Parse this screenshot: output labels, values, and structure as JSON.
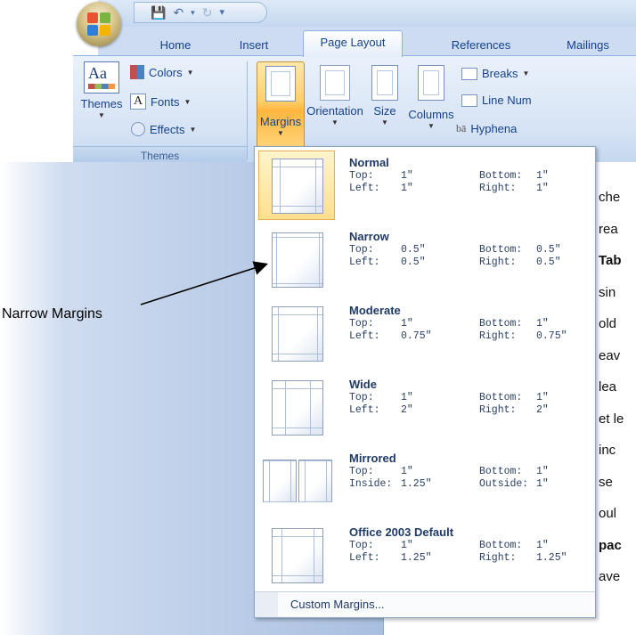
{
  "quick_access": {
    "icons": [
      "save-icon",
      "undo-icon",
      "redo-icon",
      "customize-icon"
    ]
  },
  "tabs": [
    {
      "label": "Home",
      "active": false
    },
    {
      "label": "Insert",
      "active": false
    },
    {
      "label": "Page Layout",
      "active": true
    },
    {
      "label": "References",
      "active": false
    },
    {
      "label": "Mailings",
      "active": false
    }
  ],
  "ribbon": {
    "themes_group": {
      "label": "Themes",
      "themes_button": "Themes",
      "colors": "Colors",
      "fonts": "Fonts",
      "effects": "Effects"
    },
    "page_setup": {
      "margins": "Margins",
      "orientation": "Orientation",
      "size": "Size",
      "columns": "Columns",
      "breaks": "Breaks",
      "line_numbers": "Line Num",
      "hyphenation": "Hyphena"
    }
  },
  "margins_gallery": {
    "items": [
      {
        "name": "Normal",
        "row1_label": "Top:",
        "row1_value": "1\"",
        "row1_label2": "Bottom:",
        "row1_value2": "1\"",
        "row2_label": "Left:",
        "row2_value": "1\"",
        "row2_label2": "Right:",
        "row2_value2": "1\"",
        "selected": true
      },
      {
        "name": "Narrow",
        "row1_label": "Top:",
        "row1_value": "0.5\"",
        "row1_label2": "Bottom:",
        "row1_value2": "0.5\"",
        "row2_label": "Left:",
        "row2_value": "0.5\"",
        "row2_label2": "Right:",
        "row2_value2": "0.5\"",
        "selected": false
      },
      {
        "name": "Moderate",
        "row1_label": "Top:",
        "row1_value": "1\"",
        "row1_label2": "Bottom:",
        "row1_value2": "1\"",
        "row2_label": "Left:",
        "row2_value": "0.75\"",
        "row2_label2": "Right:",
        "row2_value2": "0.75\"",
        "selected": false
      },
      {
        "name": "Wide",
        "row1_label": "Top:",
        "row1_value": "1\"",
        "row1_label2": "Bottom:",
        "row1_value2": "1\"",
        "row2_label": "Left:",
        "row2_value": "2\"",
        "row2_label2": "Right:",
        "row2_value2": "2\"",
        "selected": false
      },
      {
        "name": "Mirrored",
        "row1_label": "Top:",
        "row1_value": "1\"",
        "row1_label2": "Bottom:",
        "row1_value2": "1\"",
        "row2_label": "Inside:",
        "row2_value": "1.25\"",
        "row2_label2": "Outside:",
        "row2_value2": "1\"",
        "selected": false
      },
      {
        "name": "Office 2003 Default",
        "row1_label": "Top:",
        "row1_value": "1\"",
        "row1_label2": "Bottom:",
        "row1_value2": "1\"",
        "row2_label": "Left:",
        "row2_value": "1.25\"",
        "row2_label2": "Right:",
        "row2_value2": "1.25\"",
        "selected": false
      }
    ],
    "custom": "Custom Margins..."
  },
  "document_fragments": [
    "che",
    "rea",
    "Tab",
    "sin",
    "old",
    "eav",
    "lea",
    "et le",
    "inc",
    "se",
    "oul",
    "pac",
    "ave"
  ],
  "document_bold": [
    false,
    false,
    true,
    false,
    false,
    false,
    false,
    false,
    false,
    false,
    false,
    true,
    false
  ],
  "annotation": "Narrow Margins",
  "colors": {
    "accent_hover": "#ffcf6a",
    "ribbon_text": "#15428b",
    "tab_bg": "#cddcf0"
  }
}
